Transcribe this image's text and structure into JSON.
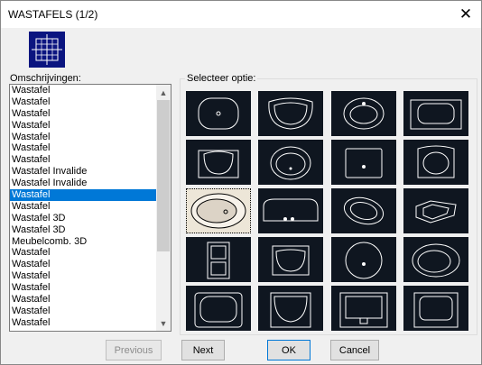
{
  "window": {
    "title": "WASTAFELS (1/2)"
  },
  "labels": {
    "descriptions": "Omschrijvingen:",
    "select_option": "Selecteer optie:"
  },
  "list": {
    "items": [
      "Wastafel",
      "Wastafel",
      "Wastafel",
      "Wastafel",
      "Wastafel",
      "Wastafel",
      "Wastafel",
      "Wastafel Invalide",
      "Wastafel Invalide",
      "Wastafel",
      "Wastafel",
      "Wastafel 3D",
      "Wastafel 3D",
      "Meubelcomb. 3D",
      "Wastafel",
      "Wastafel",
      "Wastafel",
      "Wastafel",
      "Wastafel",
      "Wastafel",
      "Wastafel"
    ],
    "selected_index": 9
  },
  "grid": {
    "rows": 5,
    "cols": 4,
    "selected_index": 8
  },
  "buttons": {
    "previous": "Previous",
    "next": "Next",
    "ok": "OK",
    "cancel": "Cancel"
  },
  "icons": {
    "close": "close-icon",
    "preview": "crosshair-grid-icon",
    "up": "scroll-up-icon",
    "down": "scroll-down-icon"
  },
  "colors": {
    "tile_bg": "#0f1620",
    "tile_selected_bg": "#ede6d8",
    "selection": "#0078d7",
    "preview_bg": "#0b1580"
  }
}
